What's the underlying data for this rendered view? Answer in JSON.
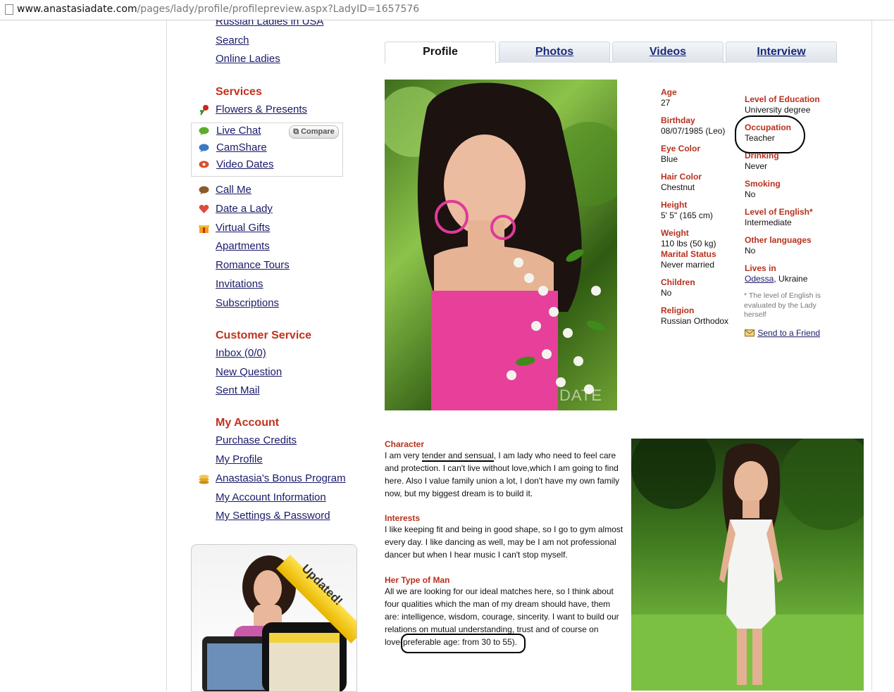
{
  "browser": {
    "url_host": "www.anastasiadate.com",
    "url_path": "/pages/lady/profile/profilepreview.aspx?LadyID=1657576"
  },
  "sidebar": {
    "top_links": [
      {
        "label": "Russian Ladies in USA"
      },
      {
        "label": "Search"
      },
      {
        "label": "Online Ladies"
      }
    ],
    "services": {
      "heading": "Services",
      "flowers": "Flowers & Presents",
      "chat_group": [
        {
          "label": "Live Chat",
          "icon": "chat-bubble-icon"
        },
        {
          "label": "CamShare",
          "icon": "camshare-icon"
        },
        {
          "label": "Video Dates",
          "icon": "video-date-icon"
        }
      ],
      "compare_label": "Compare",
      "more": [
        {
          "label": "Call Me",
          "icon": "phone-bubble-icon"
        },
        {
          "label": "Date a Lady",
          "icon": "heart-icon"
        },
        {
          "label": "Virtual Gifts",
          "icon": "gift-icon"
        },
        {
          "label": "Apartments"
        },
        {
          "label": "Romance Tours"
        },
        {
          "label": "Invitations"
        },
        {
          "label": "Subscriptions"
        }
      ]
    },
    "customer_service": {
      "heading": "Customer Service",
      "items": [
        {
          "label": "Inbox (0/0)"
        },
        {
          "label": "New Question"
        },
        {
          "label": "Sent Mail"
        }
      ]
    },
    "my_account": {
      "heading": "My Account",
      "items": [
        {
          "label": "Purchase Credits"
        },
        {
          "label": "My Profile"
        },
        {
          "label": "Anastasia's Bonus Program",
          "icon": "coins-icon"
        },
        {
          "label": "My Account Information"
        },
        {
          "label": "My Settings & Password"
        }
      ]
    },
    "promo": {
      "ribbon": "Updated!"
    }
  },
  "tabs": [
    {
      "label": "Profile",
      "active": true
    },
    {
      "label": "Photos",
      "active": false
    },
    {
      "label": "Videos",
      "active": false
    },
    {
      "label": "Interview",
      "active": false
    }
  ],
  "profile": {
    "left_fields": [
      {
        "label": "Age",
        "value": "27"
      },
      {
        "label": "Birthday",
        "value": "08/07/1985 (Leo)"
      },
      {
        "label": "Eye Color",
        "value": "Blue"
      },
      {
        "label": "Hair Color",
        "value": "Chestnut"
      },
      {
        "label": "Height",
        "value": "5' 5\" (165 cm)"
      },
      {
        "label": "Weight",
        "value": "110 lbs (50 kg)"
      },
      {
        "label": "Marital Status",
        "value": "Never married"
      },
      {
        "label": "Children",
        "value": "No"
      },
      {
        "label": "Religion",
        "value": "Russian Orthodox"
      }
    ],
    "right_fields": [
      {
        "label": "Level of Education",
        "value": "University degree"
      },
      {
        "label": "Occupation",
        "value": "Teacher"
      },
      {
        "label": "Drinking",
        "value": "Never"
      },
      {
        "label": "Smoking",
        "value": "No"
      },
      {
        "label": "Level of English*",
        "value": "Intermediate"
      },
      {
        "label": "Other languages",
        "value": "No"
      },
      {
        "label": "Lives in",
        "city": "Odessa",
        "country": ", Ukraine"
      }
    ],
    "english_note": "* The level of English is evaluated by the Lady herself",
    "send_to_friend": "Send to a Friend",
    "photo_watermark": "DATE"
  },
  "description": {
    "character_title": "Character",
    "character_prefix": "I am very ",
    "character_highlight": "tender and sensual",
    "character_rest": ", I am lady who need to feel care and protection. I can't live without love,which I am going to find here. Also I value family union a lot, I don't have my own family now, but my biggest dream is to build it.",
    "interests_title": "Interests",
    "interests_text": "I like keeping fit and being in good shape, so I go to gym almost every day. I like dancing as well, may be I am not professional dancer but when I hear music I can't stop myself.",
    "man_title": "Her Type of Man",
    "man_text": "All we are looking for our ideal matches here, so I think about four qualities which the man of my dream should have, them are: intelligence, wisdom, courage, sincerity. I want to build our relations on mutual understanding, trust and of course on love(preferable age: from 30 to 55)."
  },
  "colors": {
    "section_red": "#c0311c",
    "link_blue": "#1a1a6a"
  }
}
